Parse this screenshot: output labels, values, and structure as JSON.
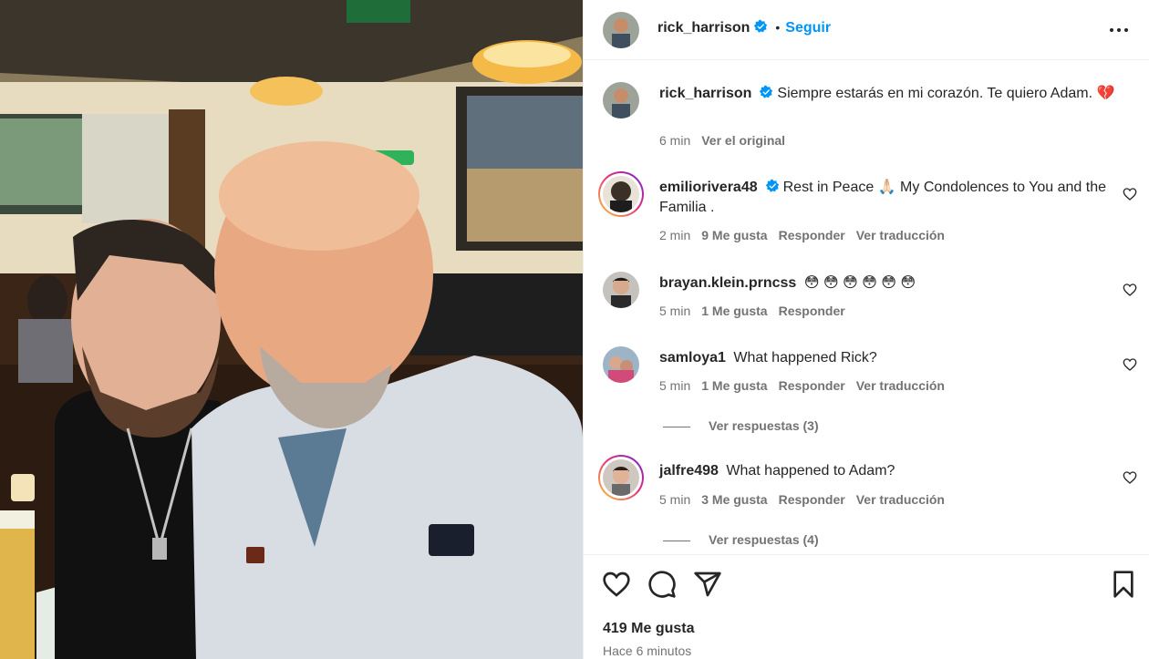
{
  "post": {
    "author": "rick_harrison",
    "follow_label": "Seguir",
    "dot": "•"
  },
  "caption": {
    "author": "rick_harrison",
    "text": "Siempre estarás en mi corazón. Te quiero Adam. 💔",
    "time": "6 min",
    "see_original": "Ver el original"
  },
  "comments": [
    {
      "user": "emiliorivera48",
      "verified": true,
      "text": "Rest in Peace 🙏🏻 My Condolences to You and the Familia .",
      "time": "2 min",
      "likes": "9 Me gusta",
      "reply": "Responder",
      "translate": "Ver traducción"
    },
    {
      "user": "brayan.klein.prncss",
      "verified": false,
      "text": "😳 😳 😳 😳 😳 😳",
      "time": "5 min",
      "likes": "1 Me gusta",
      "reply": "Responder",
      "translate": ""
    },
    {
      "user": "samloya1",
      "verified": false,
      "text": "What happened Rick?",
      "time": "5 min",
      "likes": "1 Me gusta",
      "reply": "Responder",
      "translate": "Ver traducción",
      "view_replies": "Ver respuestas (3)"
    },
    {
      "user": "jalfre498",
      "verified": false,
      "text": "What happened to Adam?",
      "time": "5 min",
      "likes": "3 Me gusta",
      "reply": "Responder",
      "translate": "Ver traducción",
      "view_replies": "Ver respuestas (4)"
    }
  ],
  "footer": {
    "likes": "419 Me gusta",
    "time": "Hace 6 minutos"
  },
  "colors": {
    "link": "#0095f6",
    "muted": "#737373",
    "verified": "#0095f6"
  }
}
